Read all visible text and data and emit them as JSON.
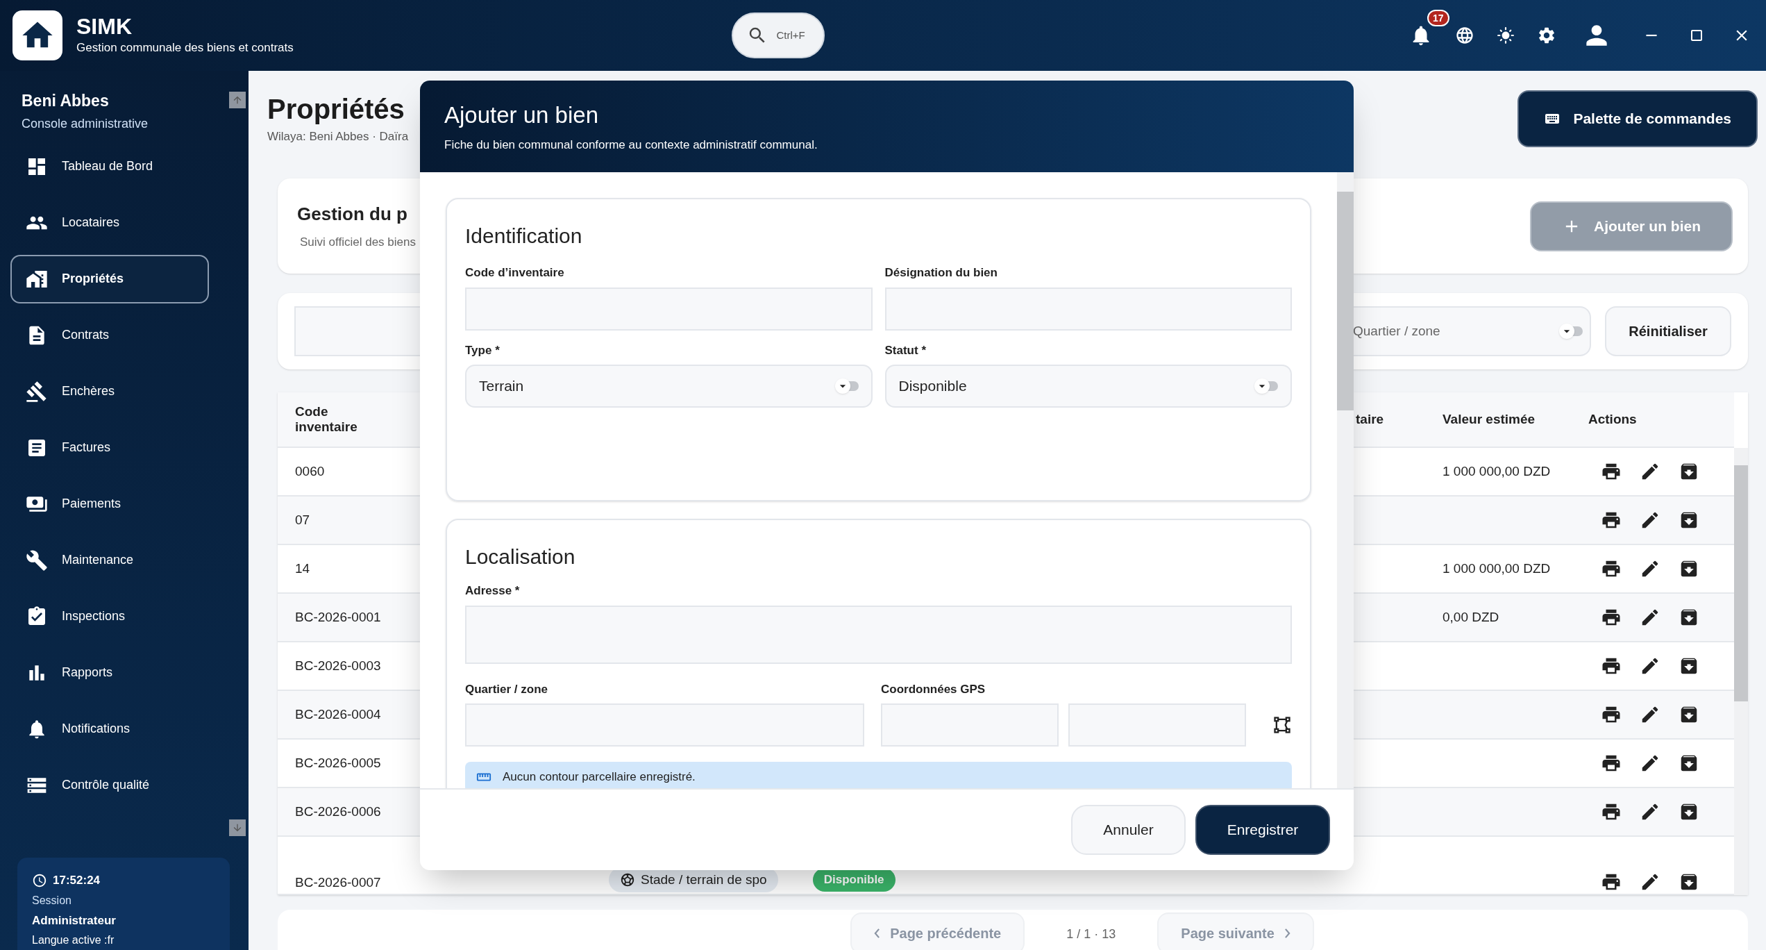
{
  "app": {
    "title": "SIMK",
    "subtitle": "Gestion communale des biens et contrats"
  },
  "search": {
    "shortcut": "Ctrl+F"
  },
  "notifications": {
    "count": "17"
  },
  "sidebar": {
    "title": "Beni Abbes",
    "subtitle": "Console administrative",
    "items": [
      {
        "label": "Tableau de Bord",
        "selected": false
      },
      {
        "label": "Locataires",
        "selected": false
      },
      {
        "label": "Propriétés",
        "selected": true
      },
      {
        "label": "Contrats",
        "selected": false
      },
      {
        "label": "Enchères",
        "selected": false
      },
      {
        "label": "Factures",
        "selected": false
      },
      {
        "label": "Paiements",
        "selected": false
      },
      {
        "label": "Maintenance",
        "selected": false
      },
      {
        "label": "Inspections",
        "selected": false
      },
      {
        "label": "Rapports",
        "selected": false
      },
      {
        "label": "Notifications",
        "selected": false
      },
      {
        "label": "Contrôle qualité",
        "selected": false
      }
    ]
  },
  "session": {
    "time": "17:52:24",
    "label": "Session",
    "role": "Administrateur",
    "language": "Langue active :fr"
  },
  "page": {
    "title": "Propriétés",
    "breadcrumb": "Wilaya: Beni Abbes · Daïra",
    "palette_button": "Palette de commandes"
  },
  "management": {
    "title": "Gestion du p",
    "subtitle": "Suivi officiel des biens",
    "add_button": "Ajouter un bien",
    "add_disabled": true
  },
  "filters": {
    "zone_placeholder": "Quartier / zone",
    "reset_button": "Réinitialiser"
  },
  "table": {
    "columns": [
      "Code inventaire",
      "taire",
      "Valeur estimée",
      "Actions"
    ],
    "rows": [
      {
        "code": "0060",
        "value": "1 000 000,00 DZD"
      },
      {
        "code": "07"
      },
      {
        "code": "14",
        "value": "1 000 000,00 DZD"
      },
      {
        "code": "BC-2026-0001",
        "value": "0,00 DZD"
      },
      {
        "code": "BC-2026-0003"
      },
      {
        "code": "BC-2026-0004"
      },
      {
        "code": "BC-2026-0005"
      },
      {
        "code": "BC-2026-0006"
      },
      {
        "code": "BC-2026-0007",
        "type": "Stade / terrain de spo",
        "status": "Disponible"
      }
    ]
  },
  "pagination": {
    "previous": "Page précédente",
    "info": "1 / 1 · 13",
    "next": "Page suivante"
  },
  "modal": {
    "title": "Ajouter un bien",
    "subtitle": "Fiche du bien communal conforme au contexte administratif communal.",
    "identification": {
      "title": "Identification",
      "code_label": "Code d’inventaire",
      "designation_label": "Désignation du bien",
      "type_label": "Type *",
      "type_value": "Terrain",
      "status_label": "Statut *",
      "status_value": "Disponible"
    },
    "localisation": {
      "title": "Localisation",
      "address_label": "Adresse *",
      "zone_label": "Quartier / zone",
      "gps_label": "Coordonnées GPS",
      "notice": "Aucun contour parcellaire enregistré."
    },
    "cancel_button": "Annuler",
    "save_button": "Enregistrer"
  }
}
